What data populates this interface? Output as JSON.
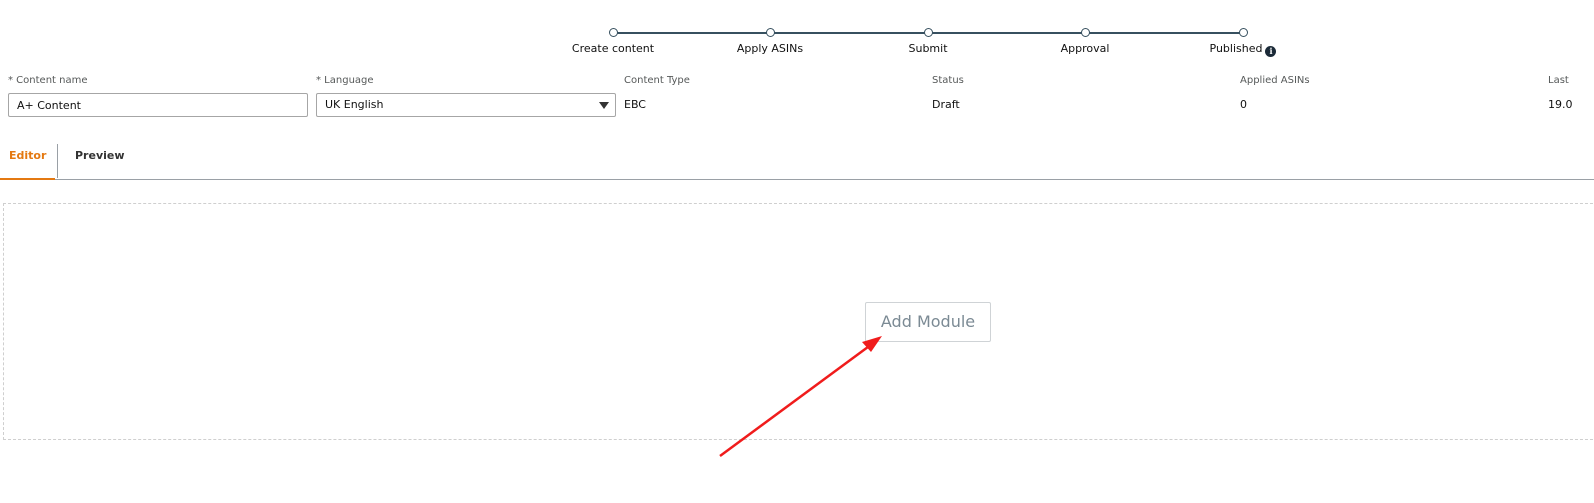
{
  "stepper": {
    "steps": [
      {
        "label": "Create content"
      },
      {
        "label": "Apply ASINs"
      },
      {
        "label": "Submit"
      },
      {
        "label": "Approval"
      },
      {
        "label": "Published"
      }
    ]
  },
  "form": {
    "content_name": {
      "label": "* Content name",
      "value": "A+ Content"
    },
    "language": {
      "label": "* Language",
      "value": "UK English"
    },
    "content_type": {
      "label": "Content Type",
      "value": "EBC"
    },
    "status": {
      "label": "Status",
      "value": "Draft"
    },
    "applied_asins": {
      "label": "Applied ASINs",
      "value": "0"
    },
    "last": {
      "label": "Last",
      "value": "19.0"
    }
  },
  "tabs": {
    "editor": "Editor",
    "preview": "Preview"
  },
  "module_area": {
    "add_module_label": "Add Module"
  },
  "colors": {
    "active_tab": "#e47911",
    "stepper_line": "#37505f",
    "annotation_arrow": "#ff0000"
  }
}
